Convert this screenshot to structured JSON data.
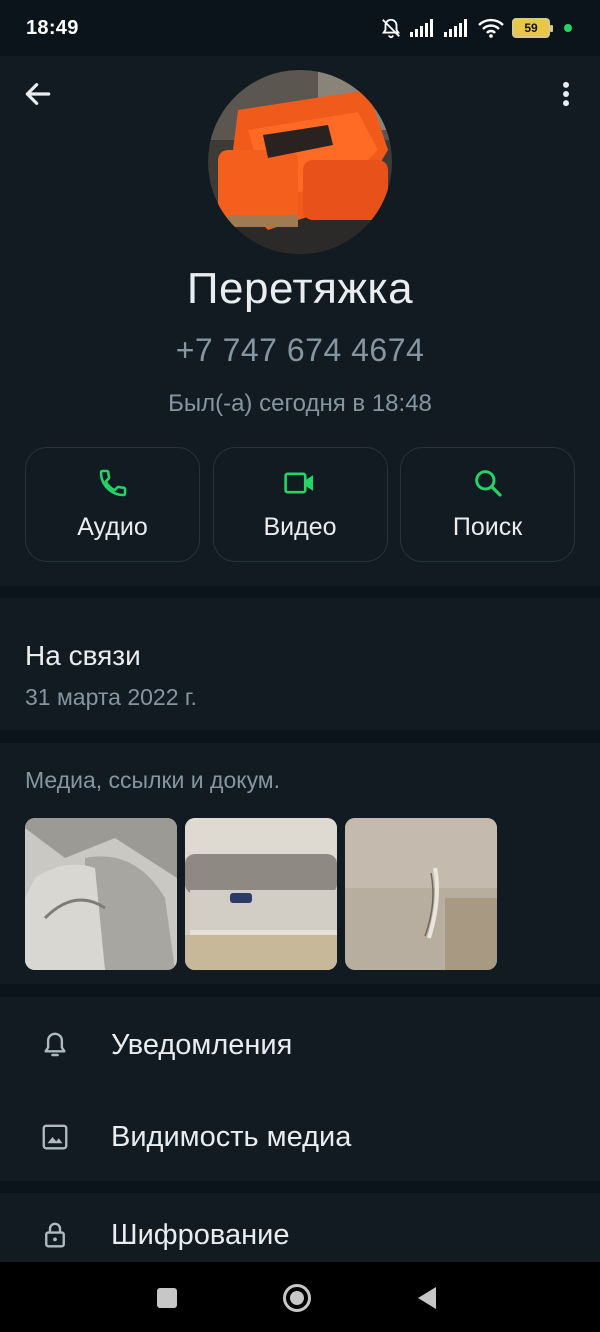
{
  "status_bar": {
    "time": "18:49",
    "battery": "59",
    "icons": [
      "muted-bell-icon",
      "signal-icon",
      "signal-icon",
      "wifi-icon",
      "battery-icon"
    ]
  },
  "contact": {
    "name": "Перетяжка",
    "phone": "+7 747 674 4674",
    "last_seen": "Был(-а) сегодня в 18:48"
  },
  "actions": [
    {
      "label": "Аудио",
      "icon": "phone-icon"
    },
    {
      "label": "Видео",
      "icon": "video-icon"
    },
    {
      "label": "Поиск",
      "icon": "search-icon"
    }
  ],
  "about": {
    "title": "На связи",
    "date": "31 марта 2022 г."
  },
  "media": {
    "title": "Медиа, ссылки и докум."
  },
  "settings": [
    {
      "label": "Уведомления",
      "icon": "bell-icon"
    },
    {
      "label": "Видимость медиа",
      "icon": "image-icon"
    }
  ],
  "encryption": {
    "label": "Шифрование",
    "icon": "lock-icon"
  },
  "colors": {
    "accent": "#25d366",
    "background": "#0b141a",
    "card": "#121b22",
    "secondary_text": "#8696a0"
  }
}
